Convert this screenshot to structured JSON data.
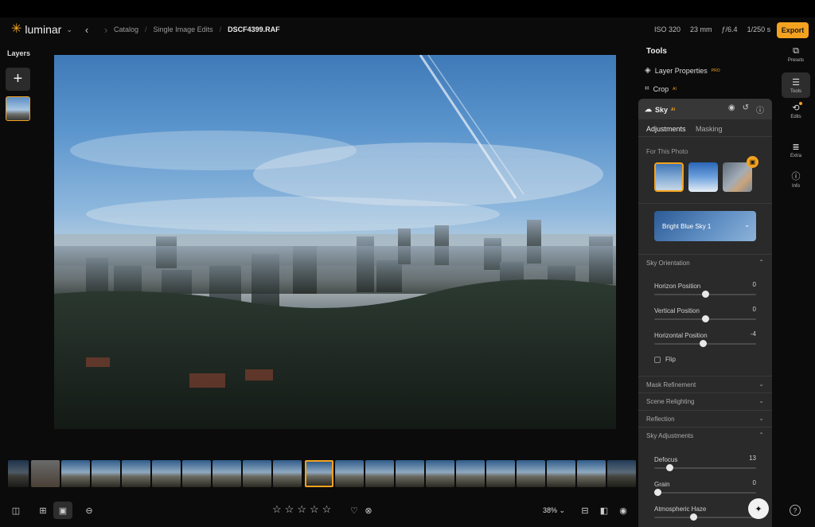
{
  "app": {
    "name": "luminar"
  },
  "nav": {
    "back": "‹",
    "forward": "›"
  },
  "breadcrumb": [
    "Catalog",
    "Single Image Edits",
    "DSCF4399.RAF"
  ],
  "exif": [
    "ISO 320",
    "23 mm",
    "ƒ/6.4",
    "1/250 s"
  ],
  "header": {
    "export_label": "Export"
  },
  "layers": {
    "title": "Layers",
    "add": "+"
  },
  "tools": {
    "title": "Tools",
    "layer_properties": "Layer Properties",
    "layer_properties_badge": "PRO",
    "crop": "Crop",
    "crop_badge": "AI"
  },
  "sky": {
    "title": "Sky",
    "badge": "AI",
    "tabs": [
      "Adjustments",
      "Masking"
    ],
    "for_this_photo": "For This Photo",
    "selected_sky": "Bright Blue Sky 1",
    "orientation": {
      "title": "Sky Orientation",
      "sliders": [
        {
          "label": "Horizon Position",
          "value": "0",
          "level": 0.5
        },
        {
          "label": "Vertical Position",
          "value": "0",
          "level": 0.5
        },
        {
          "label": "Horizontal Position",
          "value": "-4",
          "level": 0.48
        }
      ],
      "flip": "Flip"
    },
    "sections": [
      "Mask Refinement",
      "Scene Relighting",
      "Reflection",
      "Sky Adjustments"
    ],
    "adjustments": [
      {
        "label": "Defocus",
        "value": "13",
        "level": 0.15
      },
      {
        "label": "Grain",
        "value": "0",
        "level": 0.03
      },
      {
        "label": "Atmospheric Haze",
        "value": "",
        "level": 0.38
      }
    ]
  },
  "rail": [
    {
      "label": "Presets",
      "icon": "presets-icon"
    },
    {
      "label": "Tools",
      "icon": "tools-icon"
    },
    {
      "label": "Edits",
      "icon": "edits-icon"
    },
    {
      "label": "Extra",
      "icon": "extra-icon"
    },
    {
      "label": "Info",
      "icon": "info-icon"
    }
  ],
  "bottom": {
    "zoom": "38%"
  },
  "colors": {
    "accent": "#f3a21f",
    "panel": "#2a2a2a"
  }
}
